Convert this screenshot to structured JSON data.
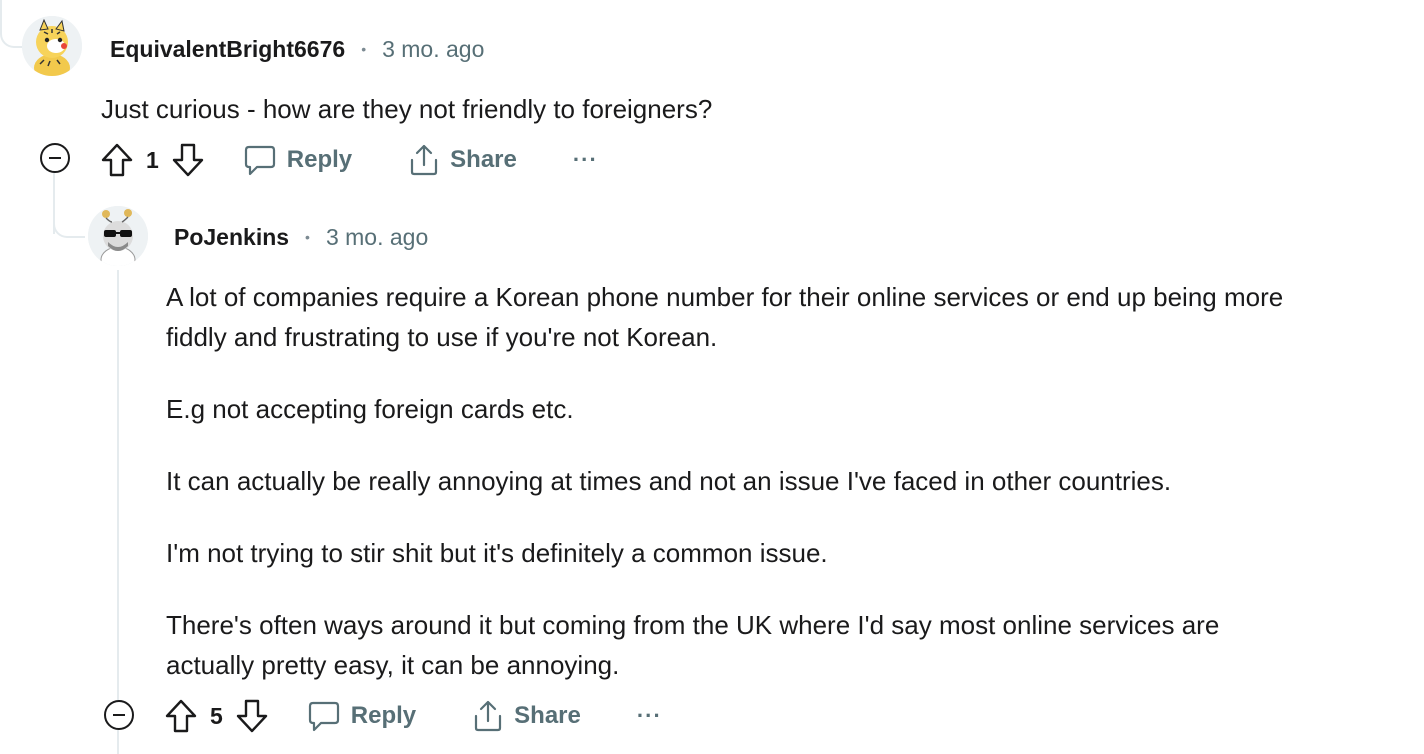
{
  "comments": [
    {
      "author": "EquivalentBright6676",
      "separator": "•",
      "time": "3 mo. ago",
      "paragraphs": [
        "Just curious - how are they not friendly to foreigners?"
      ],
      "score": "1",
      "reply_label": "Reply",
      "share_label": "Share",
      "more_label": "···"
    },
    {
      "author": "PoJenkins",
      "separator": "•",
      "time": "3 mo. ago",
      "paragraphs": [
        "A lot of companies require a Korean phone number for their online services or end up being more",
        "fiddly and frustrating to use if you're not Korean.",
        "E.g not accepting foreign cards etc.",
        "It can actually be really annoying at times and not an issue I've faced in other countries.",
        "I'm not trying to stir shit but it's definitely a common issue.",
        "There's often ways around it but coming from the UK where I'd say most online services are",
        "actually pretty easy, it can be annoying."
      ],
      "score": "5",
      "reply_label": "Reply",
      "share_label": "Share",
      "more_label": "···"
    }
  ],
  "icons": {
    "upvote": "arrow-up-outline-icon",
    "downvote": "arrow-down-outline-icon",
    "reply": "speech-bubble-icon",
    "share": "share-upload-icon",
    "collapse": "minus-circle-icon"
  },
  "colors": {
    "meta": "#576f76",
    "text": "#1a1a1b",
    "thread": "#e5ebee"
  }
}
